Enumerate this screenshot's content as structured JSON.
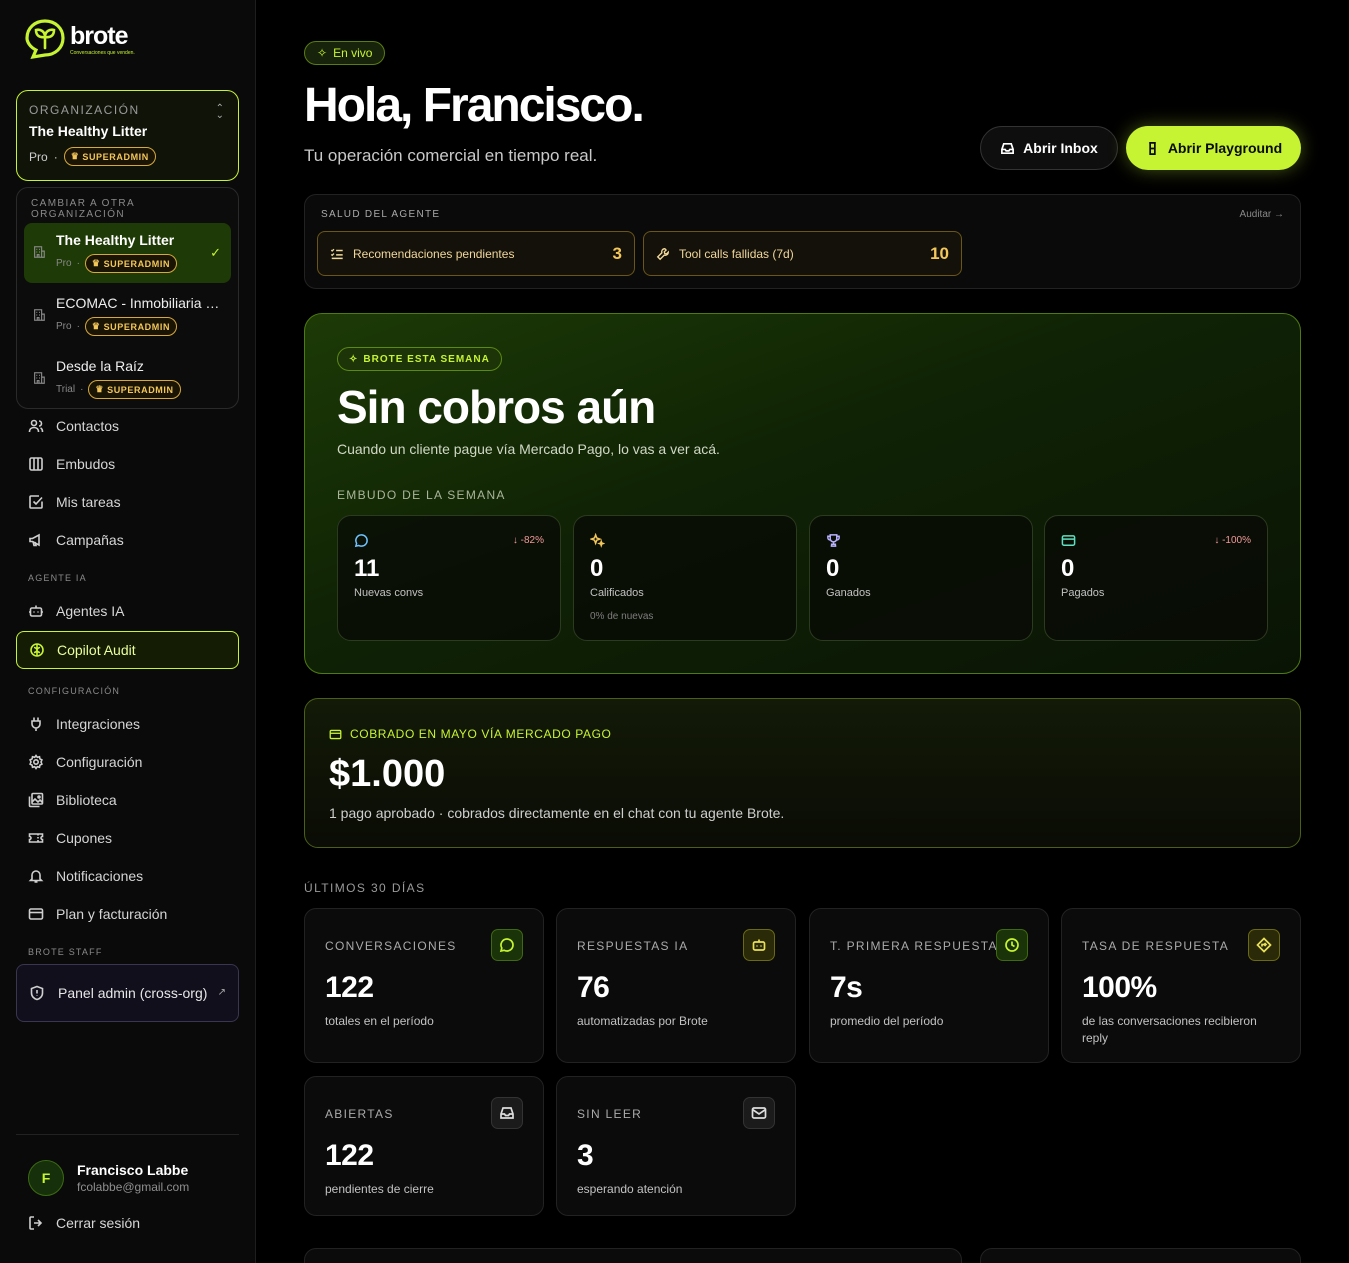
{
  "brand": {
    "name": "brote",
    "tagline": "Conversaciones que venden."
  },
  "org": {
    "label": "ORGANIZACIÓN",
    "name": "The Healthy Litter",
    "plan": "Pro",
    "badge": "SUPERADMIN"
  },
  "switcher": {
    "label": "CAMBIAR A OTRA ORGANIZACIÓN",
    "items": [
      {
        "name": "The Healthy Litter",
        "plan": "Pro",
        "badge": "SUPERADMIN",
        "active": true
      },
      {
        "name": "ECOMAC - Inmobiliaria Valdivia",
        "plan": "Pro",
        "badge": "SUPERADMIN",
        "active": false
      },
      {
        "name": "Desde la Raíz",
        "plan": "Trial",
        "badge": "SUPERADMIN",
        "active": false
      }
    ]
  },
  "nav": {
    "main": [
      "Contactos",
      "Embudos",
      "Mis tareas",
      "Campañas"
    ],
    "agent_section": "AGENTE IA",
    "agent": [
      "Agentes IA",
      "Copilot Audit"
    ],
    "config_section": "CONFIGURACIÓN",
    "config": [
      "Integraciones",
      "Configuración",
      "Biblioteca",
      "Cupones",
      "Notificaciones",
      "Plan y facturación"
    ],
    "staff_section": "BROTE STAFF",
    "admin": "Panel admin (cross-org)"
  },
  "user": {
    "initial": "F",
    "name": "Francisco Labbe",
    "email": "fcolabbe@gmail.com",
    "logout": "Cerrar sesión"
  },
  "header": {
    "live": "En vivo",
    "greeting": "Hola, Francisco.",
    "subtitle": "Tu operación comercial en tiempo real.",
    "inbox_btn": "Abrir Inbox",
    "playground_btn": "Abrir Playground"
  },
  "health": {
    "title": "SALUD DEL AGENTE",
    "link": "Auditar →",
    "cards": [
      {
        "label": "Recomendaciones pendientes",
        "value": "3"
      },
      {
        "label": "Tool calls fallidas (7d)",
        "value": "10"
      }
    ]
  },
  "week": {
    "badge": "BROTE ESTA SEMANA",
    "title": "Sin cobros aún",
    "subtitle": "Cuando un cliente pague vía Mercado Pago, lo vas a ver acá.",
    "funnel_label": "EMBUDO DE LA SEMANA",
    "funnel": [
      {
        "value": "11",
        "label": "Nuevas convs",
        "delta": "↓ -82%",
        "sub": ""
      },
      {
        "value": "0",
        "label": "Calificados",
        "delta": "",
        "sub": "0% de nuevas"
      },
      {
        "value": "0",
        "label": "Ganados",
        "delta": "",
        "sub": ""
      },
      {
        "value": "0",
        "label": "Pagados",
        "delta": "↓ -100%",
        "sub": ""
      }
    ]
  },
  "cobrado": {
    "label": "COBRADO EN MAYO VÍA MERCADO PAGO",
    "amount": "$1.000",
    "sub": "1 pago aprobado · cobrados directamente en el chat con tu agente Brote."
  },
  "metrics": {
    "label": "ÚLTIMOS 30 DÍAS",
    "cards": [
      {
        "title": "CONVERSACIONES",
        "value": "122",
        "desc": "totales en el período"
      },
      {
        "title": "RESPUESTAS IA",
        "value": "76",
        "desc": "automatizadas por Brote"
      },
      {
        "title": "T. PRIMERA RESPUESTA",
        "value": "7s",
        "desc": "promedio del período"
      },
      {
        "title": "TASA DE RESPUESTA",
        "value": "100%",
        "desc": "de las conversaciones recibieron reply"
      },
      {
        "title": "ABIERTAS",
        "value": "122",
        "desc": "pendientes de cierre"
      },
      {
        "title": "SIN LEER",
        "value": "3",
        "desc": "esperando atención"
      }
    ]
  },
  "colors": {
    "accent": "#c6f432",
    "gold": "#f3c75a",
    "bg": "#000000"
  }
}
